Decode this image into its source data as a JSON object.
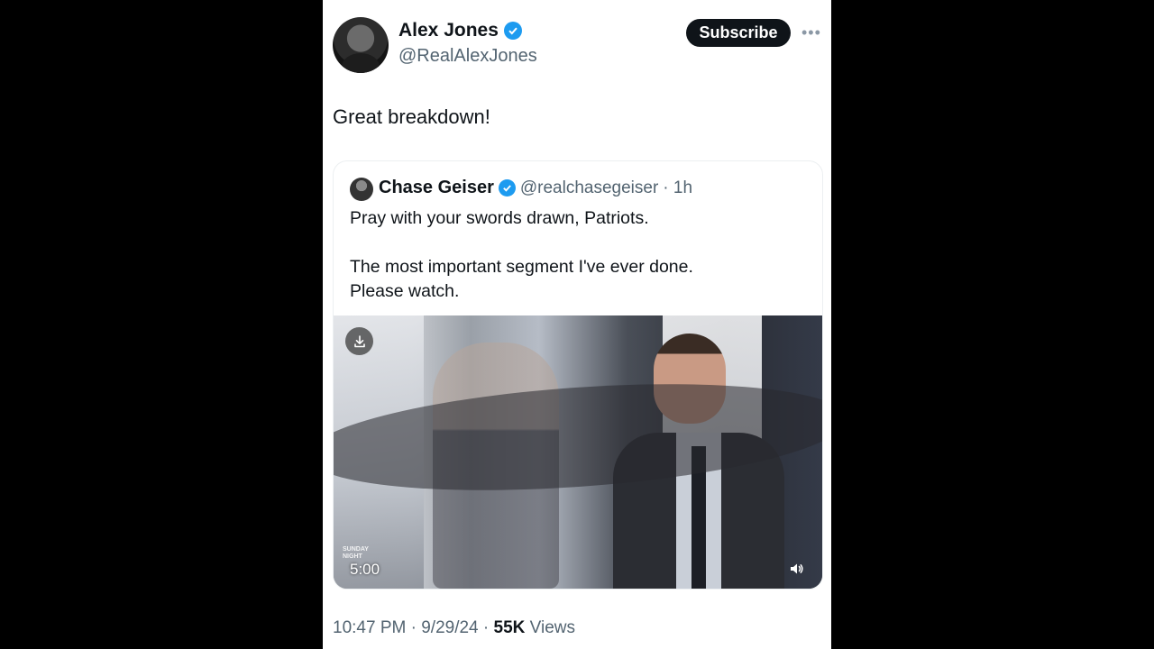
{
  "author": {
    "name": "Alex Jones",
    "handle": "@RealAlexJones",
    "verified": true,
    "verified_color": "#1d9bf0"
  },
  "actions": {
    "subscribe_label": "Subscribe",
    "more_label": "•••"
  },
  "tweet_text": "Great breakdown!",
  "quoted": {
    "name": "Chase Geiser",
    "handle": "@realchasegeiser",
    "time": "· 1h",
    "line1": "Pray with your swords drawn, Patriots.",
    "line2": "The most important segment I've ever done.",
    "line3": "Please watch.",
    "video": {
      "duration": "5:00",
      "show_logo": "SUNDAY NIGHT"
    }
  },
  "footer": {
    "time": "10:47 PM",
    "date": "9/29/24",
    "views_count": "55K",
    "views_label": "Views",
    "sep": "·"
  },
  "icons": [
    "verified-badge-icon",
    "download-icon",
    "volume-icon",
    "more-options-icon"
  ]
}
